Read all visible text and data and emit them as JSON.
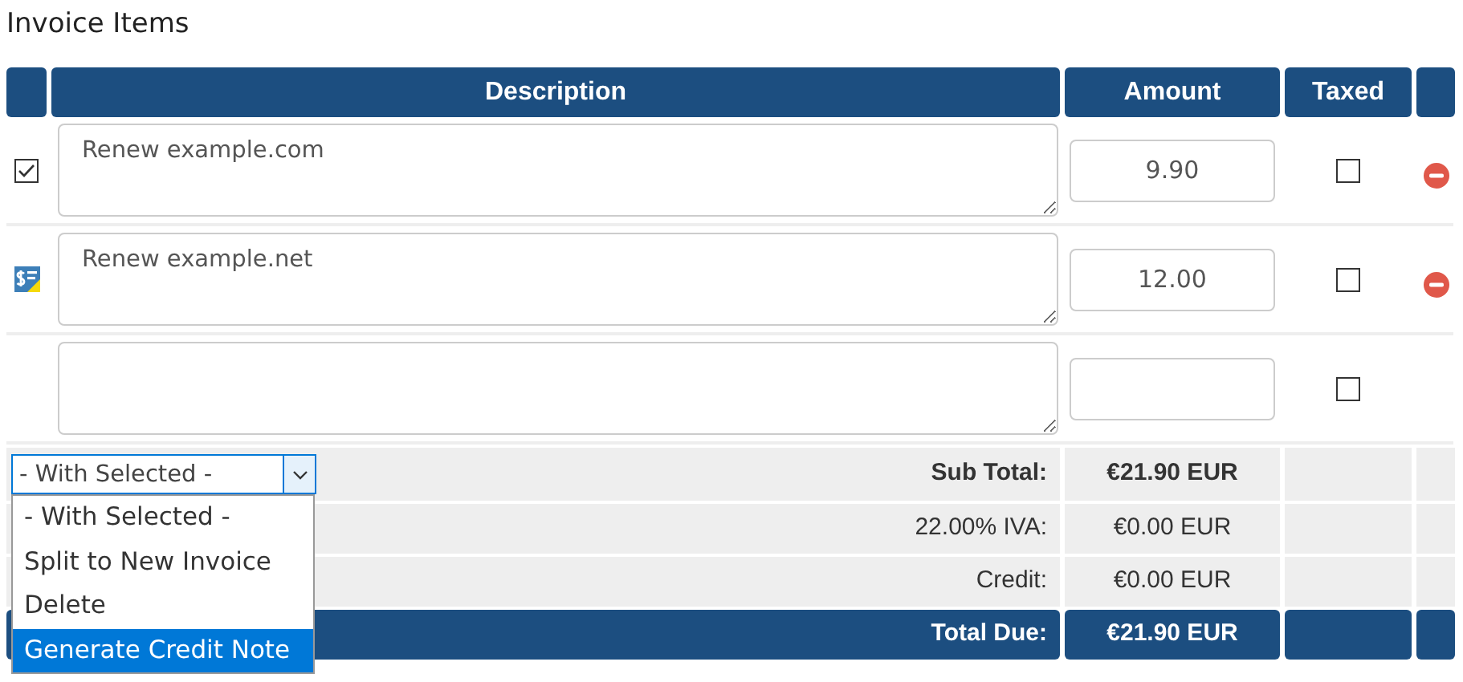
{
  "title": "Invoice Items",
  "columns": [
    "Description",
    "Amount",
    "Taxed"
  ],
  "items": [
    {
      "kind": "checkbox",
      "checked": true,
      "description": "Renew example.com",
      "amount": "9.90",
      "taxed": false,
      "deletable": true
    },
    {
      "kind": "invoiced",
      "description": "Renew example.net",
      "amount": "12.00",
      "taxed": false,
      "deletable": true
    },
    {
      "kind": "blank",
      "taxed": false,
      "deletable": false
    }
  ],
  "bulk_action": {
    "value": "- With Selected -",
    "expanded": true,
    "options": [
      {
        "label": "- With Selected -",
        "highlighted": false
      },
      {
        "label": "Split to New Invoice",
        "highlighted": false
      },
      {
        "label": "Delete",
        "highlighted": false
      },
      {
        "label": "Generate Credit Note",
        "highlighted": true
      }
    ]
  },
  "totals": [
    {
      "kind": "subtotal",
      "label": "Sub Total:",
      "value": "€21.90 EUR"
    },
    {
      "kind": "plain",
      "label": "22.00% IVA:",
      "value": "€0.00 EUR"
    },
    {
      "kind": "plain",
      "label": "Credit:",
      "value": "€0.00 EUR"
    },
    {
      "kind": "total",
      "label": "Total Due:",
      "value": "€21.90 EUR"
    }
  ]
}
